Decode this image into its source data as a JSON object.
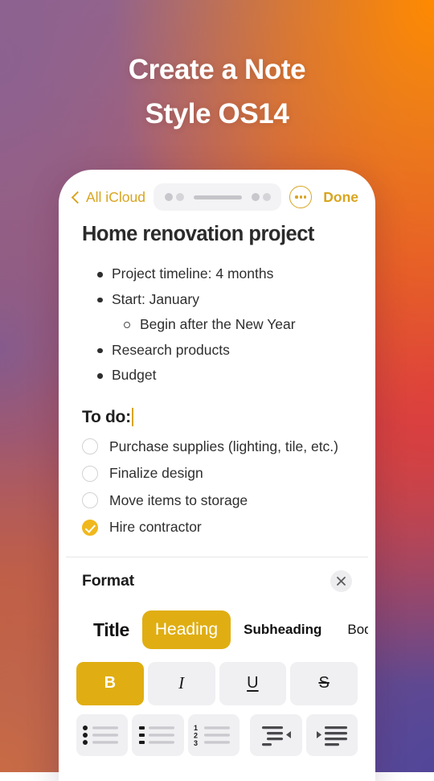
{
  "headline": {
    "line1": "Create a Note",
    "line2": "Style OS14"
  },
  "colors": {
    "accent_gold": "#D9A520",
    "selected_gold": "#E0AE12",
    "check_gold": "#F0B81C",
    "bg_purple": "#8C6190",
    "bg_orange": "#FF8A00",
    "bg_red": "#DC3B40",
    "bg_terracotta": "#C96B44",
    "bg_blue_purple": "#524699"
  },
  "navbar": {
    "back_label": "All iCloud",
    "back_icon": "chevron-left-icon",
    "more_icon": "ellipsis-circle-icon",
    "done_label": "Done",
    "handle_icon": "drag-handle"
  },
  "note": {
    "title": "Home renovation project",
    "bullets": [
      {
        "text": "Project timeline: 4 months",
        "level": 1
      },
      {
        "text": "Start: January",
        "level": 1
      },
      {
        "text": "Begin after the New Year",
        "level": 2
      },
      {
        "text": "Research products",
        "level": 1
      },
      {
        "text": "Budget",
        "level": 1
      }
    ],
    "todo_heading": "To do:",
    "checklist": [
      {
        "label": "Purchase supplies (lighting, tile, etc.)",
        "checked": false
      },
      {
        "label": "Finalize design",
        "checked": false
      },
      {
        "label": "Move items to storage",
        "checked": false
      },
      {
        "label": "Hire contractor",
        "checked": true
      }
    ]
  },
  "format": {
    "title": "Format",
    "close_icon": "close-icon",
    "styles": [
      {
        "label": "Title",
        "selected": false
      },
      {
        "label": "Heading",
        "selected": true
      },
      {
        "label": "Subheading",
        "selected": false
      },
      {
        "label": "Bod",
        "selected": false
      }
    ],
    "text_styles": [
      {
        "label": "B",
        "name": "bold",
        "selected": true
      },
      {
        "label": "I",
        "name": "italic",
        "selected": false
      },
      {
        "label": "U",
        "name": "underline",
        "selected": false
      },
      {
        "label": "S",
        "name": "strikethrough",
        "selected": false
      }
    ],
    "list_buttons": [
      {
        "name": "bulleted-list",
        "numbers": [
          "",
          "",
          ""
        ]
      },
      {
        "name": "dashed-list",
        "numbers": [
          "",
          "",
          ""
        ]
      },
      {
        "name": "numbered-list",
        "numbers": [
          "1",
          "2",
          "3"
        ]
      },
      {
        "name": "outdent",
        "numbers": []
      },
      {
        "name": "indent",
        "numbers": []
      }
    ]
  }
}
